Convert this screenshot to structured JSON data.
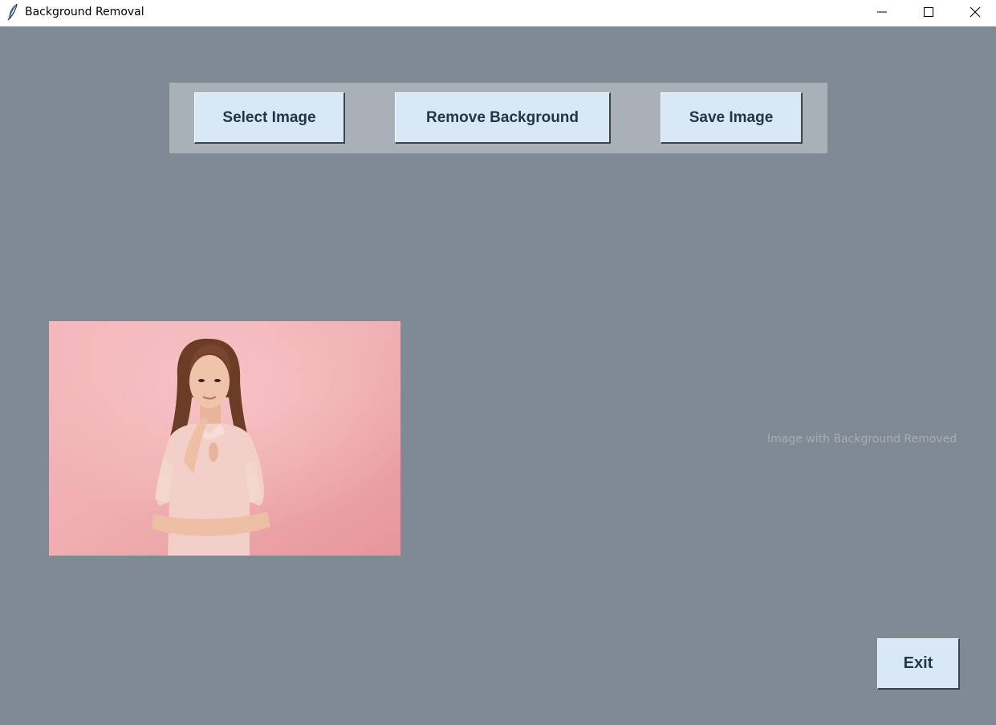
{
  "window": {
    "title": "Background Removal",
    "background_color": "#808a94",
    "icons": {
      "app": "feather-icon",
      "minimize": "minimize-icon",
      "maximize": "maximize-icon",
      "close": "close-icon"
    }
  },
  "toolbar": {
    "select_label": "Select Image",
    "remove_label": "Remove Background",
    "save_label": "Save Image",
    "button_color": "#d8e8f6",
    "text_color": "#233549"
  },
  "content": {
    "original_image": "photo of woman in pink dress on pink background",
    "result_placeholder": "Image with Background Removed"
  },
  "footer": {
    "exit_label": "Exit"
  }
}
